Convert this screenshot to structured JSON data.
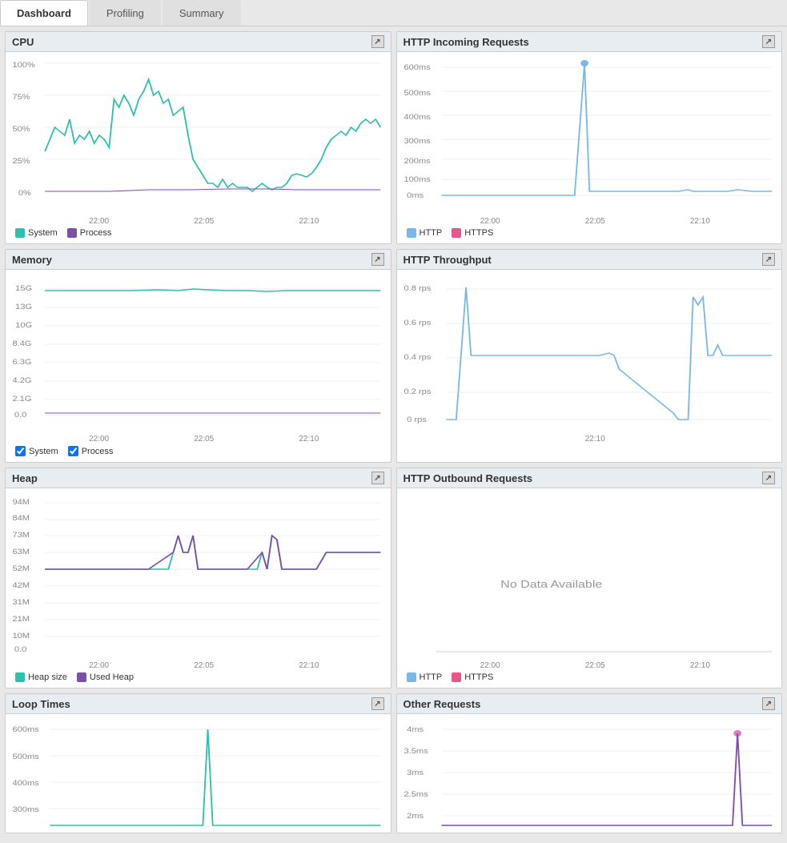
{
  "tabs": [
    {
      "label": "Dashboard",
      "active": true
    },
    {
      "label": "Profiling",
      "active": false
    },
    {
      "label": "Summary",
      "active": false
    }
  ],
  "panels": {
    "cpu": {
      "title": "CPU",
      "legend": [
        {
          "label": "System",
          "color": "teal"
        },
        {
          "label": "Process",
          "color": "purple"
        }
      ],
      "x_labels": [
        "22:00",
        "22:05",
        "22:10"
      ]
    },
    "http_incoming": {
      "title": "HTTP Incoming Requests",
      "legend": [
        {
          "label": "HTTP",
          "color": "blue"
        },
        {
          "label": "HTTPS",
          "color": "pink"
        }
      ],
      "x_labels": [
        "22:00",
        "22:05",
        "22:10"
      ],
      "y_labels": [
        "600ms",
        "500ms",
        "400ms",
        "300ms",
        "200ms",
        "100ms",
        "0ms"
      ]
    },
    "memory": {
      "title": "Memory",
      "legend": [
        {
          "label": "System",
          "color": "teal"
        },
        {
          "label": "Process",
          "color": "purple"
        }
      ],
      "x_labels": [
        "22:00",
        "22:05",
        "22:10"
      ],
      "y_labels": [
        "15G",
        "13G",
        "10G",
        "8.4G",
        "6.3G",
        "4.2G",
        "2.1G",
        "0.0"
      ]
    },
    "http_throughput": {
      "title": "HTTP Throughput",
      "legend": [],
      "x_labels": [
        "22:10"
      ],
      "y_labels": [
        "0.8 rps",
        "0.6 rps",
        "0.4 rps",
        "0.2 rps",
        "0 rps"
      ]
    },
    "heap": {
      "title": "Heap",
      "legend": [
        {
          "label": "Heap size",
          "color": "teal"
        },
        {
          "label": "Used Heap",
          "color": "purple"
        }
      ],
      "x_labels": [
        "22:00",
        "22:05",
        "22:10"
      ],
      "y_labels": [
        "94M",
        "84M",
        "73M",
        "63M",
        "52M",
        "42M",
        "31M",
        "21M",
        "10M",
        "0.0"
      ]
    },
    "http_outbound": {
      "title": "HTTP Outbound Requests",
      "no_data": "No Data Available",
      "legend": [
        {
          "label": "HTTP",
          "color": "blue"
        },
        {
          "label": "HTTPS",
          "color": "pink"
        }
      ],
      "x_labels": [
        "22:00",
        "22:05",
        "22:10"
      ]
    },
    "loop_times": {
      "title": "Loop Times",
      "y_labels": [
        "600ms",
        "500ms",
        "400ms",
        "300ms"
      ],
      "x_labels": []
    },
    "other_requests": {
      "title": "Other Requests",
      "y_labels": [
        "4ms",
        "3.5ms",
        "3ms",
        "2.5ms",
        "2ms"
      ],
      "x_labels": []
    }
  },
  "icons": {
    "expand": "&#x2197;"
  }
}
